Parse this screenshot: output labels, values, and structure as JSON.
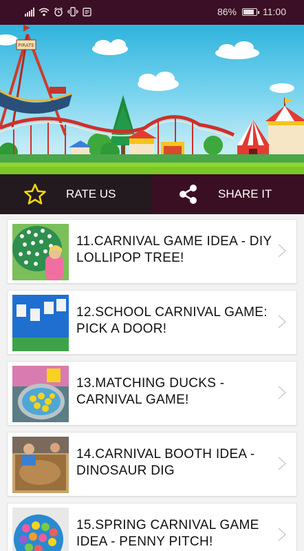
{
  "status_bar": {
    "battery_percent_text": "86%",
    "battery_level": 0.86,
    "time": "11:00",
    "icons": [
      "signal-icon",
      "wifi-icon",
      "alarm-icon",
      "vibrate-icon",
      "notification-icon",
      "battery-icon"
    ]
  },
  "banner": {
    "sign_text": "PIRATE"
  },
  "actions": {
    "rate_label": "RATE US",
    "share_label": "SHARE IT",
    "rate_icon": "star-icon",
    "share_icon": "share-icon"
  },
  "items": [
    {
      "title": "11.CARNIVAL GAME IDEA - DIY LOLLIPOP TREE!"
    },
    {
      "title": "12.SCHOOL CARNIVAL GAME: PICK A DOOR!"
    },
    {
      "title": "13.MATCHING DUCKS - CARNIVAL GAME!"
    },
    {
      "title": "14.CARNIVAL BOOTH IDEA - DINOSAUR DIG"
    },
    {
      "title": "15.SPRING CARNIVAL GAME IDEA - PENNY PITCH!"
    }
  ],
  "colors": {
    "status_bar_bg": "#3b0f25",
    "rate_bg": "#231a1f",
    "share_bg": "#3a0f24",
    "star": "#f5d90a"
  }
}
